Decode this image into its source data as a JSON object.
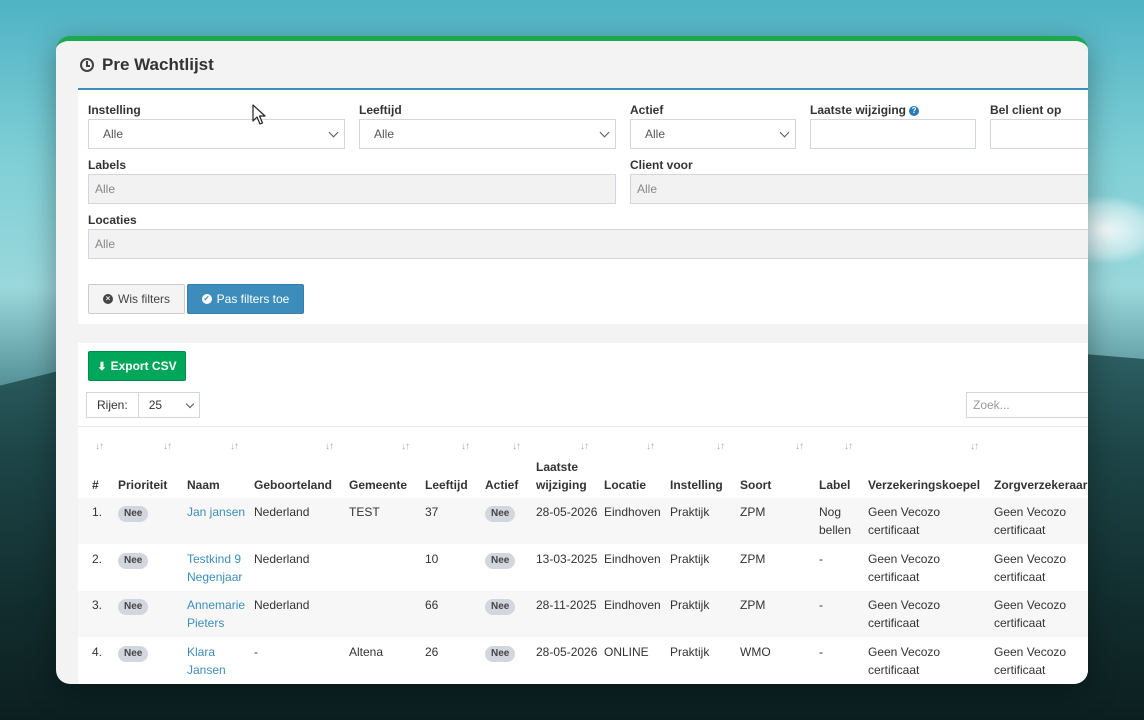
{
  "page": {
    "title": "Pre Wachtlijst"
  },
  "filters": {
    "instelling": {
      "label": "Instelling",
      "value": "Alle"
    },
    "leeftijd": {
      "label": "Leeftijd",
      "value": "Alle"
    },
    "actief": {
      "label": "Actief",
      "value": "Alle"
    },
    "laatste_wijziging": {
      "label": "Laatste wijziging",
      "value": ""
    },
    "bel_client_op": {
      "label": "Bel client op",
      "value": ""
    },
    "labels": {
      "label": "Labels",
      "placeholder": "Alle"
    },
    "client_voor": {
      "label": "Client voor",
      "placeholder": "Alle"
    },
    "locaties": {
      "label": "Locaties",
      "placeholder": "Alle"
    },
    "clear_button": "Wis filters",
    "apply_button": "Pas filters toe"
  },
  "toolbar": {
    "export_button": "Export CSV",
    "rows_label": "Rijen:",
    "rows_value": "25",
    "search_placeholder": "Zoek..."
  },
  "table": {
    "headers": {
      "num": "#",
      "prioriteit": "Prioriteit",
      "naam": "Naam",
      "geboorteland": "Geboorteland",
      "gemeente": "Gemeente",
      "leeftijd": "Leeftijd",
      "actief": "Actief",
      "laatste_wijziging_1": "Laatste",
      "laatste_wijziging_2": "wijziging",
      "locatie": "Locatie",
      "instelling": "Instelling",
      "soort": "Soort",
      "label": "Label",
      "verzekeringskoepel": "Verzekeringskoepel",
      "zorgverzekeraar": "Zorgverzekeraar"
    },
    "rows": [
      {
        "num": "1.",
        "prioriteit": "Nee",
        "naam_1": "Jan jansen",
        "naam_2": "",
        "geboorteland": "Nederland",
        "gemeente": "TEST",
        "leeftijd": "37",
        "actief": "Nee",
        "wijziging": "28-05-2026",
        "locatie": "Eindhoven",
        "instelling": "Praktijk",
        "soort": "ZPM",
        "label_1": "Nog",
        "label_2": "bellen",
        "koepel_1": "Geen Vecozo",
        "koepel_2": "certificaat",
        "zorg_1": "Geen Vecozo",
        "zorg_2": "certificaat"
      },
      {
        "num": "2.",
        "prioriteit": "Nee",
        "naam_1": "Testkind 9",
        "naam_2": "Negenjaar",
        "geboorteland": "Nederland",
        "gemeente": "",
        "leeftijd": "10",
        "actief": "Nee",
        "wijziging": "13-03-2025",
        "locatie": "Eindhoven",
        "instelling": "Praktijk",
        "soort": "ZPM",
        "label_1": "-",
        "label_2": "",
        "koepel_1": "Geen Vecozo",
        "koepel_2": "certificaat",
        "zorg_1": "Geen Vecozo",
        "zorg_2": "certificaat"
      },
      {
        "num": "3.",
        "prioriteit": "Nee",
        "naam_1": "Annemarie",
        "naam_2": "Pieters",
        "geboorteland": "Nederland",
        "gemeente": "",
        "leeftijd": "66",
        "actief": "Nee",
        "wijziging": "28-11-2025",
        "locatie": "Eindhoven",
        "instelling": "Praktijk",
        "soort": "ZPM",
        "label_1": "-",
        "label_2": "",
        "koepel_1": "Geen Vecozo",
        "koepel_2": "certificaat",
        "zorg_1": "Geen Vecozo",
        "zorg_2": "certificaat"
      },
      {
        "num": "4.",
        "prioriteit": "Nee",
        "naam_1": "Klara",
        "naam_2": "Jansen",
        "geboorteland": "-",
        "gemeente": "Altena",
        "leeftijd": "26",
        "actief": "Nee",
        "wijziging": "28-05-2026",
        "locatie": "ONLINE",
        "instelling": "Praktijk",
        "soort": "WMO",
        "label_1": "-",
        "label_2": "",
        "koepel_1": "Geen Vecozo",
        "koepel_2": "certificaat",
        "zorg_1": "Geen Vecozo",
        "zorg_2": "certificaat"
      }
    ]
  },
  "colors": {
    "accent_green": "#00a65a",
    "primary_blue": "#3c8dbc",
    "link_blue": "#3c8dbc"
  }
}
